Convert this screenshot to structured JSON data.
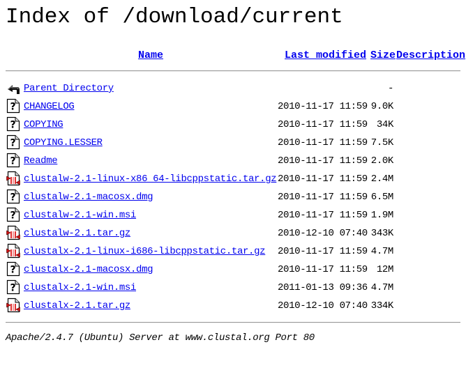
{
  "page": {
    "title": "Index of /download/current"
  },
  "columns": {
    "name": "Name",
    "last_modified": "Last modified",
    "size": "Size",
    "description": "Description"
  },
  "rows": [
    {
      "icon": "back-icon",
      "name": "Parent Directory",
      "date": "",
      "size": "-"
    },
    {
      "icon": "unknown-file-icon",
      "name": "CHANGELOG",
      "date": "2010-11-17 11:59",
      "size": "9.0K"
    },
    {
      "icon": "unknown-file-icon",
      "name": "COPYING",
      "date": "2010-11-17 11:59",
      "size": "34K"
    },
    {
      "icon": "unknown-file-icon",
      "name": "COPYING.LESSER",
      "date": "2010-11-17 11:59",
      "size": "7.5K"
    },
    {
      "icon": "unknown-file-icon",
      "name": "Readme",
      "date": "2010-11-17 11:59",
      "size": "2.0K"
    },
    {
      "icon": "compressed-file-icon",
      "name": "clustalw-2.1-linux-x86_64-libcppstatic.tar.gz",
      "date": "2010-11-17 11:59",
      "size": "2.4M"
    },
    {
      "icon": "unknown-file-icon",
      "name": "clustalw-2.1-macosx.dmg",
      "date": "2010-11-17 11:59",
      "size": "6.5M"
    },
    {
      "icon": "unknown-file-icon",
      "name": "clustalw-2.1-win.msi",
      "date": "2010-11-17 11:59",
      "size": "1.9M"
    },
    {
      "icon": "compressed-file-icon",
      "name": "clustalw-2.1.tar.gz",
      "date": "2010-12-10 07:40",
      "size": "343K"
    },
    {
      "icon": "compressed-file-icon",
      "name": "clustalx-2.1-linux-i686-libcppstatic.tar.gz",
      "date": "2010-11-17 11:59",
      "size": "4.7M"
    },
    {
      "icon": "unknown-file-icon",
      "name": "clustalx-2.1-macosx.dmg",
      "date": "2010-11-17 11:59",
      "size": "12M"
    },
    {
      "icon": "unknown-file-icon",
      "name": "clustalx-2.1-win.msi",
      "date": "2011-01-13 09:36",
      "size": "4.7M"
    },
    {
      "icon": "compressed-file-icon",
      "name": "clustalx-2.1.tar.gz",
      "date": "2010-12-10 07:40",
      "size": "334K"
    }
  ],
  "footer": {
    "server_signature": "Apache/2.4.7 (Ubuntu) Server at www.clustal.org Port 80"
  }
}
